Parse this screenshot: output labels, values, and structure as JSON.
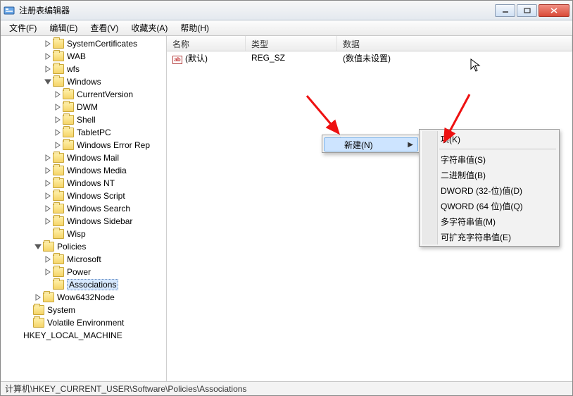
{
  "window": {
    "title": "注册表编辑器"
  },
  "menu": {
    "file": "文件(F)",
    "edit": "编辑(E)",
    "view": "查看(V)",
    "favorites": "收藏夹(A)",
    "help": "帮助(H)"
  },
  "tree": {
    "items": [
      {
        "indent": 4,
        "twisty": "right",
        "label": "SystemCertificates"
      },
      {
        "indent": 4,
        "twisty": "right",
        "label": "WAB"
      },
      {
        "indent": 4,
        "twisty": "right",
        "label": "wfs"
      },
      {
        "indent": 4,
        "twisty": "down",
        "label": "Windows"
      },
      {
        "indent": 5,
        "twisty": "right",
        "label": "CurrentVersion"
      },
      {
        "indent": 5,
        "twisty": "right",
        "label": "DWM"
      },
      {
        "indent": 5,
        "twisty": "right",
        "label": "Shell"
      },
      {
        "indent": 5,
        "twisty": "right",
        "label": "TabletPC"
      },
      {
        "indent": 5,
        "twisty": "right",
        "label": "Windows Error Rep"
      },
      {
        "indent": 4,
        "twisty": "right",
        "label": "Windows Mail"
      },
      {
        "indent": 4,
        "twisty": "right",
        "label": "Windows Media"
      },
      {
        "indent": 4,
        "twisty": "right",
        "label": "Windows NT"
      },
      {
        "indent": 4,
        "twisty": "right",
        "label": "Windows Script"
      },
      {
        "indent": 4,
        "twisty": "right",
        "label": "Windows Search"
      },
      {
        "indent": 4,
        "twisty": "right",
        "label": "Windows Sidebar"
      },
      {
        "indent": 4,
        "twisty": "none",
        "label": "Wisp"
      },
      {
        "indent": 3,
        "twisty": "down",
        "label": "Policies"
      },
      {
        "indent": 4,
        "twisty": "right",
        "label": "Microsoft"
      },
      {
        "indent": 4,
        "twisty": "right",
        "label": "Power"
      },
      {
        "indent": 4,
        "twisty": "none",
        "label": "Associations",
        "selected": true
      },
      {
        "indent": 3,
        "twisty": "right",
        "label": "Wow6432Node"
      },
      {
        "indent": 2,
        "twisty": "none",
        "label": "System"
      },
      {
        "indent": 2,
        "twisty": "none",
        "label": "Volatile Environment"
      },
      {
        "indent": 1,
        "twisty": "none",
        "label": "HKEY_LOCAL_MACHINE",
        "nofolder": true
      }
    ]
  },
  "list": {
    "headers": {
      "name": "名称",
      "type": "类型",
      "data": "数据"
    },
    "rows": [
      {
        "name": "(默认)",
        "type": "REG_SZ",
        "data": "(数值未设置)"
      }
    ]
  },
  "context_menu": {
    "new": "新建(N)",
    "submenu": {
      "key": "项(K)",
      "string": "字符串值(S)",
      "binary": "二进制值(B)",
      "dword": "DWORD (32-位)值(D)",
      "qword": "QWORD (64 位)值(Q)",
      "multi": "多字符串值(M)",
      "expand": "可扩充字符串值(E)"
    }
  },
  "statusbar": {
    "path": "计算机\\HKEY_CURRENT_USER\\Software\\Policies\\Associations"
  }
}
